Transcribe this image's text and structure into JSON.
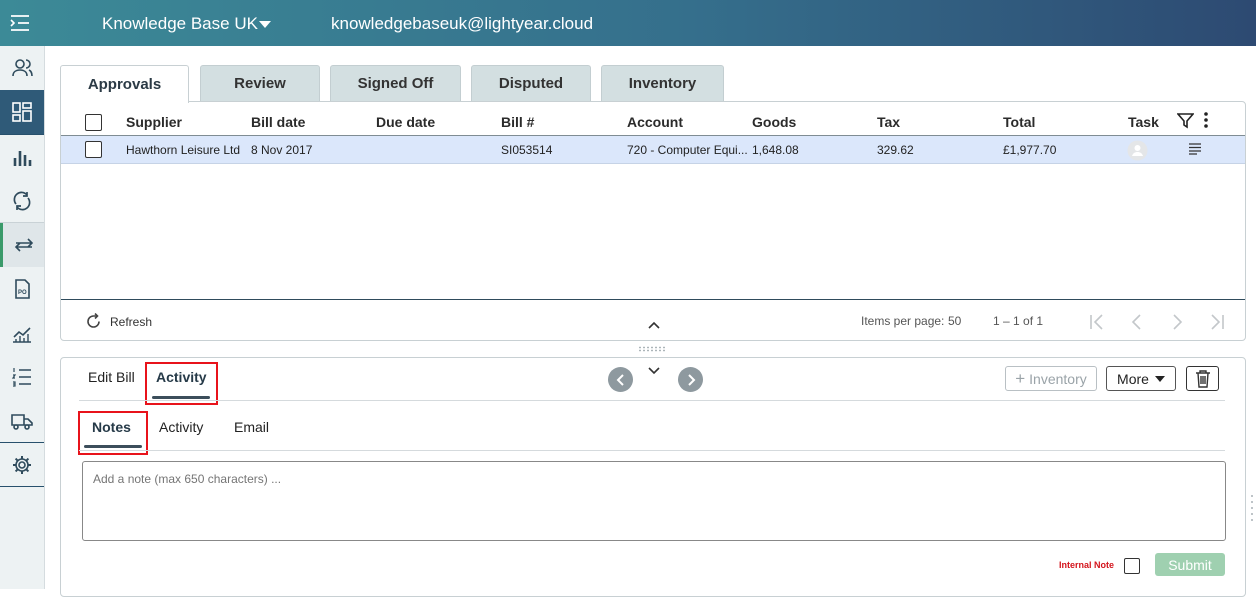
{
  "header": {
    "org_name": "Knowledge Base UK",
    "email": "knowledgebaseuk@lightyear.cloud"
  },
  "sidebar": {
    "icons": [
      "users-icon",
      "dashboard-icon",
      "chart-icon",
      "sync-icon",
      "transfer-icon",
      "po-document-icon",
      "analytics-icon",
      "list-icon",
      "truck-icon",
      "settings-icon"
    ],
    "po_label": "PO"
  },
  "grid": {
    "tabs": [
      {
        "label": "Approvals",
        "active": true
      },
      {
        "label": "Review"
      },
      {
        "label": "Signed Off"
      },
      {
        "label": "Disputed"
      },
      {
        "label": "Inventory"
      }
    ],
    "columns": [
      "Supplier",
      "Bill date",
      "Due date",
      "Bill #",
      "Account",
      "Goods",
      "Tax",
      "Total",
      "Task"
    ],
    "rows": [
      {
        "supplier": "Hawthorn Leisure Ltd",
        "bill_date": "8 Nov 2017",
        "due_date": "",
        "bill_no": "SI053514",
        "account": "720 - Computer Equi...",
        "goods": "1,648.08",
        "tax": "329.62",
        "total": "£1,977.70"
      }
    ],
    "footer": {
      "refresh_label": "Refresh",
      "items_per_page_label": "Items per page:",
      "items_per_page": "50",
      "range": "1 – 1 of 1"
    }
  },
  "detail": {
    "tabs": [
      {
        "label": "Edit Bill"
      },
      {
        "label": "Activity",
        "active": true
      }
    ],
    "inventory_button": "Inventory",
    "more_button": "More",
    "subtabs": [
      {
        "label": "Notes",
        "active": true
      },
      {
        "label": "Activity"
      },
      {
        "label": "Email"
      }
    ],
    "note_placeholder": "Add a note (max 650 characters) ...",
    "internal_note_label": "Internal Note",
    "submit_label": "Submit"
  },
  "colors": {
    "accent_red": "#e8131b",
    "submit_green": "#9fd0b0",
    "row_highlight": "#dbe7fb"
  }
}
